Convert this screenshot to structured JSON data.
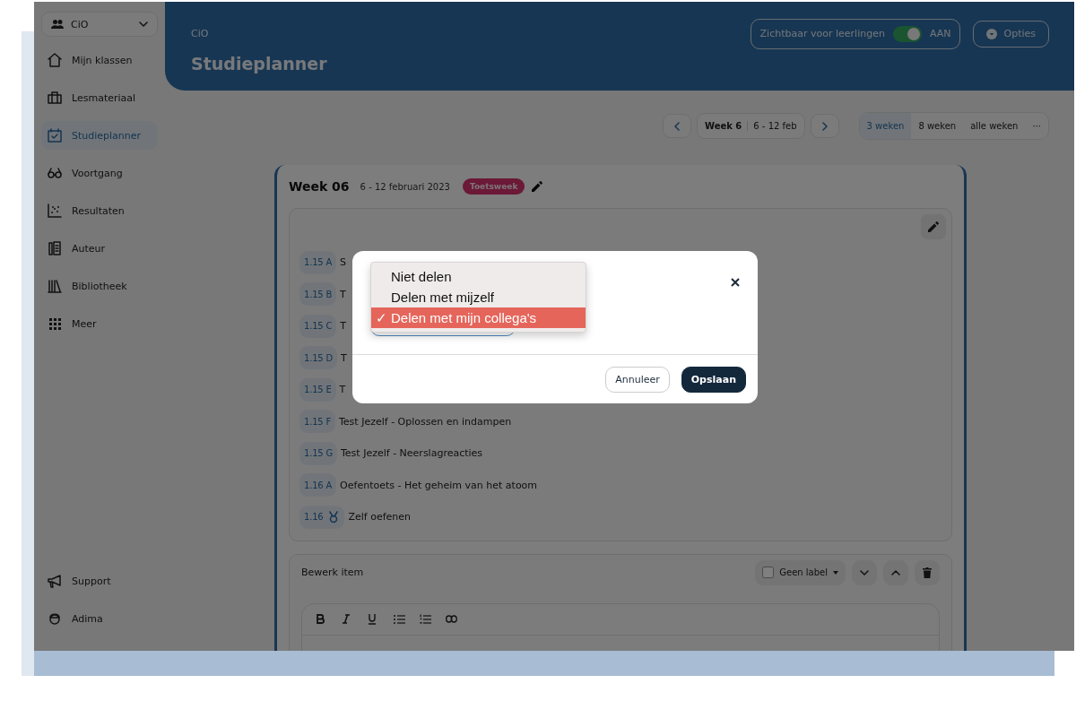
{
  "team_selector": {
    "label": "CiO"
  },
  "sidebar": {
    "items": [
      {
        "label": "Mijn klassen",
        "selected": false
      },
      {
        "label": "Lesmateriaal",
        "selected": false
      },
      {
        "label": "Studieplanner",
        "selected": true
      },
      {
        "label": "Voortgang",
        "selected": false
      },
      {
        "label": "Resultaten",
        "selected": false
      },
      {
        "label": "Auteur",
        "selected": false
      },
      {
        "label": "Bibliotheek",
        "selected": false
      },
      {
        "label": "Meer",
        "selected": false
      }
    ],
    "footer_items": [
      {
        "label": "Support"
      },
      {
        "label": "Adima"
      }
    ]
  },
  "header": {
    "breadcrumb": "CiO",
    "title": "Studieplanner",
    "visibility": {
      "label": "Zichtbaar voor leerlingen",
      "on": true,
      "state_text": "AAN"
    },
    "options_button": "Opties"
  },
  "week_nav": {
    "week_label": "Week 6",
    "range": "6 - 12 feb",
    "views": [
      {
        "label": "3 weken",
        "selected": true
      },
      {
        "label": "8 weken",
        "selected": false
      },
      {
        "label": "alle weken",
        "selected": false
      }
    ],
    "more": "···"
  },
  "week": {
    "title": "Week 06",
    "dates": "6 - 12 februari 2023",
    "tag": "Toetsweek",
    "items": [
      {
        "code": "1.15 A",
        "title": "S",
        "kind": "lesson"
      },
      {
        "code": "1.15 B",
        "title": "T",
        "kind": "lesson"
      },
      {
        "code": "1.15 C",
        "title": "T",
        "kind": "lesson"
      },
      {
        "code": "1.15 D",
        "title": "T",
        "kind": "lesson"
      },
      {
        "code": "1.15 E",
        "title": "T",
        "kind": "lesson"
      },
      {
        "code": "1.15 F",
        "title": "Test Jezelf - Oplossen en indampen",
        "kind": "lesson"
      },
      {
        "code": "1.15 G",
        "title": "Test Jezelf - Neerslagreacties",
        "kind": "lesson"
      },
      {
        "code": "1.16 A",
        "title": "Oefentoets - Het geheim van het atoom",
        "kind": "lesson"
      },
      {
        "code": "1.16",
        "title": "Zelf oefenen",
        "kind": "practice"
      }
    ]
  },
  "edit_item": {
    "title": "Bewerk item",
    "label_picker": {
      "label": "Geen label",
      "checked": false
    }
  },
  "dialog": {
    "options": [
      {
        "label": "Niet delen",
        "selected": false
      },
      {
        "label": "Delen met mijzelf",
        "selected": false
      },
      {
        "label": "Delen met mijn collega's",
        "selected": true
      }
    ],
    "check_mark": "✓",
    "buttons": [
      {
        "label": "Annuleer",
        "kind": "secondary"
      },
      {
        "label": "Opslaan",
        "kind": "primary"
      }
    ]
  }
}
